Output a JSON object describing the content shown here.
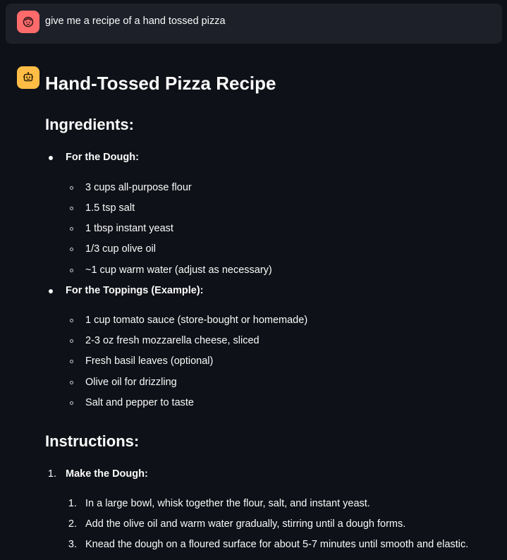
{
  "user_message": {
    "avatar_icon": "user-face-icon",
    "text": "give me a recipe of a hand tossed pizza"
  },
  "assistant_message": {
    "avatar_icon": "robot-icon",
    "title": "Hand-Tossed Pizza Recipe",
    "ingredients_heading": "Ingredients:",
    "dough_heading": "For the Dough:",
    "dough_items": [
      "3 cups all-purpose flour",
      "1.5 tsp salt",
      "1 tbsp instant yeast",
      "1/3 cup olive oil",
      "~1 cup warm water (adjust as necessary)"
    ],
    "toppings_heading": "For the Toppings (Example):",
    "toppings_items": [
      "1 cup tomato sauce (store-bought or homemade)",
      "2-3 oz fresh mozzarella cheese, sliced",
      "Fresh basil leaves (optional)",
      "Olive oil for drizzling",
      "Salt and pepper to taste"
    ],
    "instructions_heading": "Instructions:",
    "step1_number": "1.",
    "step1_heading": "Make the Dough:",
    "step1_substeps": [
      {
        "number": "1.",
        "text": "In a large bowl, whisk together the flour, salt, and instant yeast."
      },
      {
        "number": "2.",
        "text": "Add the olive oil and warm water gradually, stirring until a dough forms."
      },
      {
        "number": "3.",
        "text": "Knead the dough on a floured surface for about 5-7 minutes until smooth and elastic."
      }
    ]
  },
  "colors": {
    "background": "#0e1117",
    "user_bubble": "#1d2029",
    "user_avatar": "#ff6b6b",
    "assistant_avatar": "#ffbd45",
    "text": "#fafafa"
  }
}
